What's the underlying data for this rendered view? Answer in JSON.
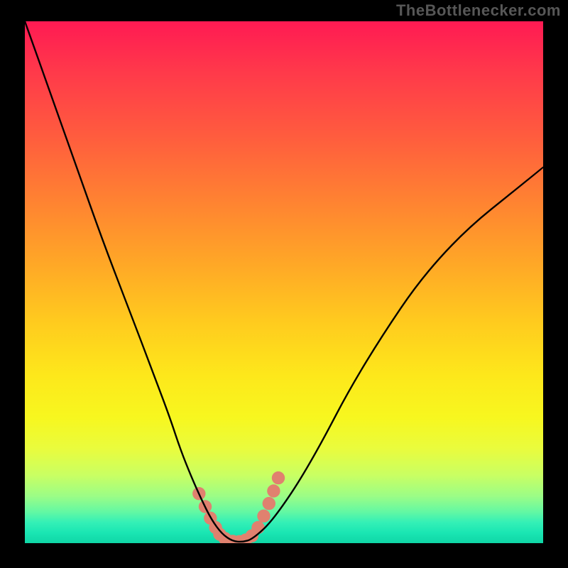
{
  "watermark": "TheBottlenecker.com",
  "chart_data": {
    "type": "line",
    "title": "",
    "xlabel": "",
    "ylabel": "",
    "xlim": [
      0,
      100
    ],
    "ylim": [
      0,
      100
    ],
    "series": [
      {
        "name": "curve",
        "color": "#000000",
        "x": [
          0,
          5,
          10,
          15,
          20,
          25,
          28,
          30,
          32,
          34,
          36,
          38,
          40,
          42,
          44,
          48,
          55,
          65,
          80,
          100
        ],
        "y": [
          100,
          86,
          72,
          58,
          45,
          32,
          24,
          18,
          13,
          8.5,
          4.5,
          1.8,
          0.4,
          0.2,
          0.8,
          4.5,
          15,
          34,
          56,
          72
        ]
      }
    ],
    "highlight": {
      "name": "valley-markers",
      "color": "#e0816f",
      "x": [
        33.6,
        34.8,
        35.8,
        36.8,
        37.6,
        38.6,
        40.1,
        41.4,
        42.6,
        43.8,
        45.0,
        46.1,
        47.1,
        48.0,
        48.9
      ],
      "y": [
        9.5,
        7.0,
        4.8,
        3.0,
        1.7,
        0.9,
        0.35,
        0.3,
        0.6,
        1.4,
        3.0,
        5.2,
        7.6,
        10.0,
        12.5
      ]
    },
    "gradient_stops": [
      {
        "pos": 0.0,
        "color": "#ff1a53"
      },
      {
        "pos": 0.34,
        "color": "#ff8132"
      },
      {
        "pos": 0.68,
        "color": "#fde81b"
      },
      {
        "pos": 0.91,
        "color": "#9bfd86"
      },
      {
        "pos": 1.0,
        "color": "#0fd6a6"
      }
    ]
  }
}
